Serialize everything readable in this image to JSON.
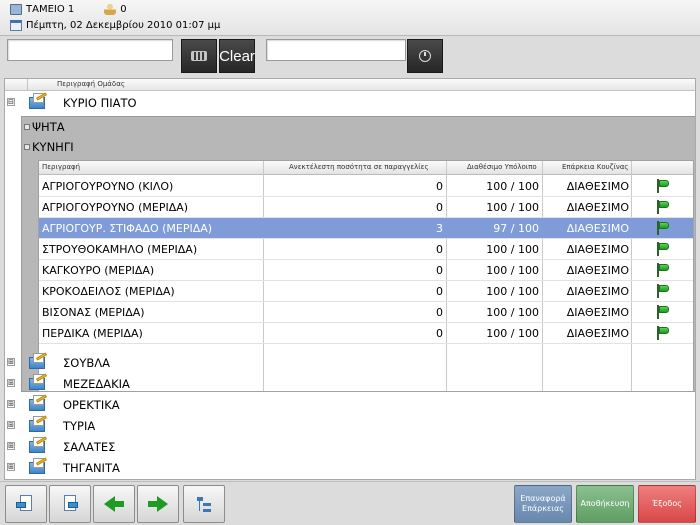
{
  "header": {
    "register": "ΤΑΜΕΙΟ 1",
    "user_count": "0",
    "datetime": "Πέμπτη, 02 Δεκεμβρίου 2010 01:07 μμ"
  },
  "toolbar": {
    "search_value": "",
    "clear_label": "Clear",
    "second_value": ""
  },
  "grid": {
    "group_header": "Περιγραφή Ομάδας",
    "groups_top": [
      {
        "label": "ΚΥΡΙΟ ΠΙΑΤΟ",
        "expander": "⊟"
      }
    ],
    "subgroups": [
      {
        "label": "ΨΗΤΑ"
      },
      {
        "label": "ΚΥΝΗΓΙ"
      }
    ],
    "table": {
      "columns": [
        "Περιγραφή",
        "Ανεκτέλεστη ποσότητα σε παραγγελίες",
        "Διαθέσιμο Υπόλοιπο",
        "Επάρκεια Κουζίνας"
      ],
      "rows": [
        {
          "desc": "ΑΓΡΙΟΓΟΥΡΟΥΝΟ (ΚΙΛΟ)",
          "pending": "0",
          "available": "100 / 100",
          "status": "ΔΙΑΘΕΣΙΜΟ",
          "selected": false
        },
        {
          "desc": "ΑΓΡΙΟΓΟΥΡΟΥΝΟ (ΜΕΡΙΔΑ)",
          "pending": "0",
          "available": "100 / 100",
          "status": "ΔΙΑΘΕΣΙΜΟ",
          "selected": false
        },
        {
          "desc": "ΑΓΡΙΟΓΟΥΡ. ΣΤΙΦΑΔΟ (ΜΕΡΙΔΑ)",
          "pending": "3",
          "available": "97 / 100",
          "status": "ΔΙΑΘΕΣΙΜΟ",
          "selected": true
        },
        {
          "desc": "ΣΤΡΟΥΘΟΚΑΜΗΛΟ (ΜΕΡΙΔΑ)",
          "pending": "0",
          "available": "100 / 100",
          "status": "ΔΙΑΘΕΣΙΜΟ",
          "selected": false
        },
        {
          "desc": "ΚΑΓΚΟΥΡΟ (ΜΕΡΙΔΑ)",
          "pending": "0",
          "available": "100 / 100",
          "status": "ΔΙΑΘΕΣΙΜΟ",
          "selected": false
        },
        {
          "desc": "ΚΡΟΚΟΔΕΙΛΟΣ (ΜΕΡΙΔΑ)",
          "pending": "0",
          "available": "100 / 100",
          "status": "ΔΙΑΘΕΣΙΜΟ",
          "selected": false
        },
        {
          "desc": "ΒΙΣΟΝΑΣ (ΜΕΡΙΔΑ)",
          "pending": "0",
          "available": "100 / 100",
          "status": "ΔΙΑΘΕΣΙΜΟ",
          "selected": false
        },
        {
          "desc": "ΠΕΡΔΙΚΑ (ΜΕΡΙΔΑ)",
          "pending": "0",
          "available": "100 / 100",
          "status": "ΔΙΑΘΕΣΙΜΟ",
          "selected": false
        }
      ]
    },
    "groups_bottom": [
      {
        "label": "ΣΟΥΒΛΑ",
        "expander": "⊞"
      },
      {
        "label": "ΜΕΖΕΔΑΚΙΑ",
        "expander": "⊞"
      },
      {
        "label": "ΟΡΕΚΤΙΚΑ",
        "expander": "⊞"
      },
      {
        "label": "ΤΥΡΙΑ",
        "expander": "⊞"
      },
      {
        "label": "ΣΑΛΑΤΕΣ",
        "expander": "⊞"
      },
      {
        "label": "ΤΗΓΑΝΙΤΑ",
        "expander": "⊞"
      }
    ]
  },
  "bottom": {
    "restore_label": "Επαναφορά Επάρκειας",
    "save_label": "Αποθήκευση",
    "exit_label": "Έξοδος"
  },
  "colors": {
    "selected_row": "#7f9cd8",
    "restore": "#6888ae",
    "save": "#5e9e63",
    "exit": "#d94848",
    "flag": "#1e9a1e"
  }
}
